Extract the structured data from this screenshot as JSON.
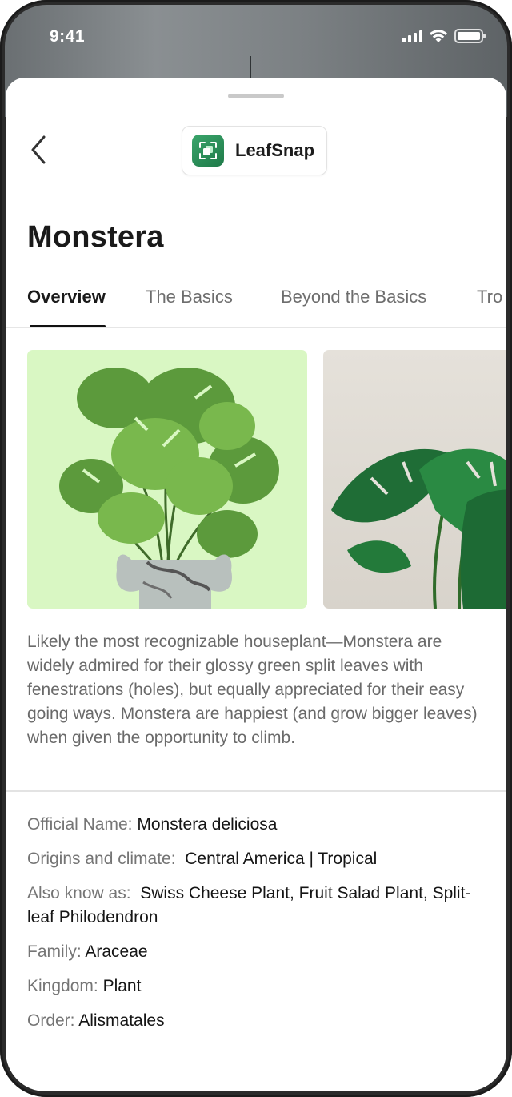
{
  "status_bar": {
    "time": "9:41"
  },
  "header": {
    "app_name": "LeafSnap"
  },
  "page": {
    "title": "Monstera"
  },
  "tabs": [
    {
      "label": "Overview",
      "active": true
    },
    {
      "label": "The Basics",
      "active": false
    },
    {
      "label": "Beyond the Basics",
      "active": false
    },
    {
      "label": "Tro",
      "active": false
    }
  ],
  "description": "Likely the most recognizable houseplant—Monstera are widely admired for their glossy green split leaves with fenestrations (holes), but equally appreciated for their easy going ways. Monstera are happiest (and grow bigger leaves) when given the opportunity to climb.",
  "details": [
    {
      "label": "Official Name:",
      "value": "Monstera deliciosa"
    },
    {
      "label": "Origins and climate:",
      "value": "Central America | Tropical"
    },
    {
      "label": "Also know as:",
      "value": "Swiss Cheese Plant, Fruit Salad Plant, Split-leaf Philodendron"
    },
    {
      "label": "Family:",
      "value": "Araceae"
    },
    {
      "label": "Kingdom:",
      "value": "Plant"
    },
    {
      "label": "Order:",
      "value": "Alismatales"
    }
  ],
  "colors": {
    "accent": "#1f7a49",
    "photo1_background": "#d9f7c3",
    "text_primary": "#1a1a1a",
    "text_secondary": "#6a6a6a"
  },
  "icons": [
    "back-chevron-icon",
    "leafsnap-logo-icon",
    "signal-icon",
    "wifi-icon",
    "battery-icon"
  ]
}
